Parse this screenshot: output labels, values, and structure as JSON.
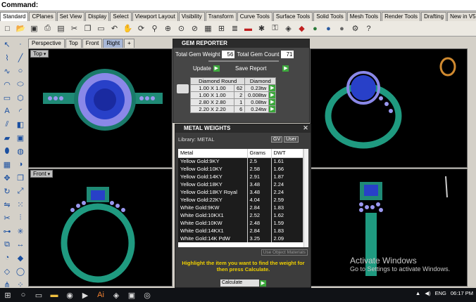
{
  "command": {
    "label": "Command:"
  },
  "tabs": [
    "Standard",
    "CPlanes",
    "Set View",
    "Display",
    "Select",
    "Viewport Layout",
    "Visibility",
    "Transform",
    "Curve Tools",
    "Surface Tools",
    "Solid Tools",
    "Mesh Tools",
    "Render Tools",
    "Drafting",
    "New in V5"
  ],
  "toolbar_icons": [
    "new-icon",
    "open-icon",
    "save-icon",
    "print-icon",
    "import-icon",
    "cut-icon",
    "copy-icon",
    "paste-icon",
    "undo-icon",
    "pan-icon",
    "rotate-icon",
    "zoom-icon",
    "zoom-window-icon",
    "zoom-extents-icon",
    "zoom-selected-icon",
    "grid-icon",
    "4view-icon",
    "layer-icon",
    "car-icon",
    "light-icon",
    "lock-icon",
    "material-icon",
    "render-icon",
    "sphere-icon",
    "sphere2-icon",
    "sphere3-icon",
    "options-icon",
    "help-icon"
  ],
  "viewport_tabs": [
    "Perspective",
    "Top",
    "Front",
    "Right",
    "+"
  ],
  "viewports": {
    "top": {
      "label": "Top"
    },
    "front": {
      "label": "Front"
    }
  },
  "gem_reporter": {
    "title": "GEM REPORTER",
    "total_weight_label": "Total Gem Weight",
    "total_weight": "56",
    "total_count_label": "Total Gem Count",
    "total_count": "71",
    "update_label": "Update",
    "save_label": "Save Report",
    "col_shape": "Diamond Round",
    "col_type": "Diamond",
    "rows": [
      {
        "size": "1.00 X 1.00",
        "count": "62",
        "weight": "0.23tw"
      },
      {
        "size": "1.00 X 1.00",
        "count": "2",
        "weight": "0.008tw"
      },
      {
        "size": "2.80 X 2.80",
        "count": "1",
        "weight": "0.08tw"
      },
      {
        "size": "2.20 X 2.20",
        "count": "6",
        "weight": "0.24tw"
      }
    ]
  },
  "metal_weights": {
    "title": "METAL WEIGHTS",
    "library": "Library: METAL",
    "gv_label": "GV",
    "user_label": "User",
    "col_metal": "Metal",
    "col_grams": "Grams",
    "col_dwt": "DWT",
    "rows": [
      {
        "metal": "Yellow Gold:9KY",
        "grams": "2.5",
        "dwt": "1.61"
      },
      {
        "metal": "Yellow Gold:10KY",
        "grams": "2.58",
        "dwt": "1.66"
      },
      {
        "metal": "Yellow Gold:14KY",
        "grams": "2.91",
        "dwt": "1.87"
      },
      {
        "metal": "Yellow Gold:18KY",
        "grams": "3.48",
        "dwt": "2.24"
      },
      {
        "metal": "Yellow Gold:18KY Royal",
        "grams": "3.48",
        "dwt": "2.24"
      },
      {
        "metal": "Yellow Gold:22KY",
        "grams": "4.04",
        "dwt": "2.59"
      },
      {
        "metal": "White Gold:9KW",
        "grams": "2.84",
        "dwt": "1.83"
      },
      {
        "metal": "White Gold:10KX1",
        "grams": "2.52",
        "dwt": "1.62"
      },
      {
        "metal": "White Gold:10KW",
        "grams": "2.48",
        "dwt": "1.59"
      },
      {
        "metal": "White Gold:14KX1",
        "grams": "2.84",
        "dwt": "1.83"
      },
      {
        "metal": "White Gold:14K PdW",
        "grams": "3.25",
        "dwt": "2.09"
      }
    ],
    "use_object_label": "Use Object Materials",
    "instruction": "Highlight the item you want to find the weight for then press Calculate.",
    "calculate_label": "Calculate"
  },
  "watermark": {
    "line1": "Activate Windows",
    "line2": "Go to Settings to activate Windows."
  },
  "tray": {
    "language": "ENG",
    "time": "06:17 PM"
  }
}
